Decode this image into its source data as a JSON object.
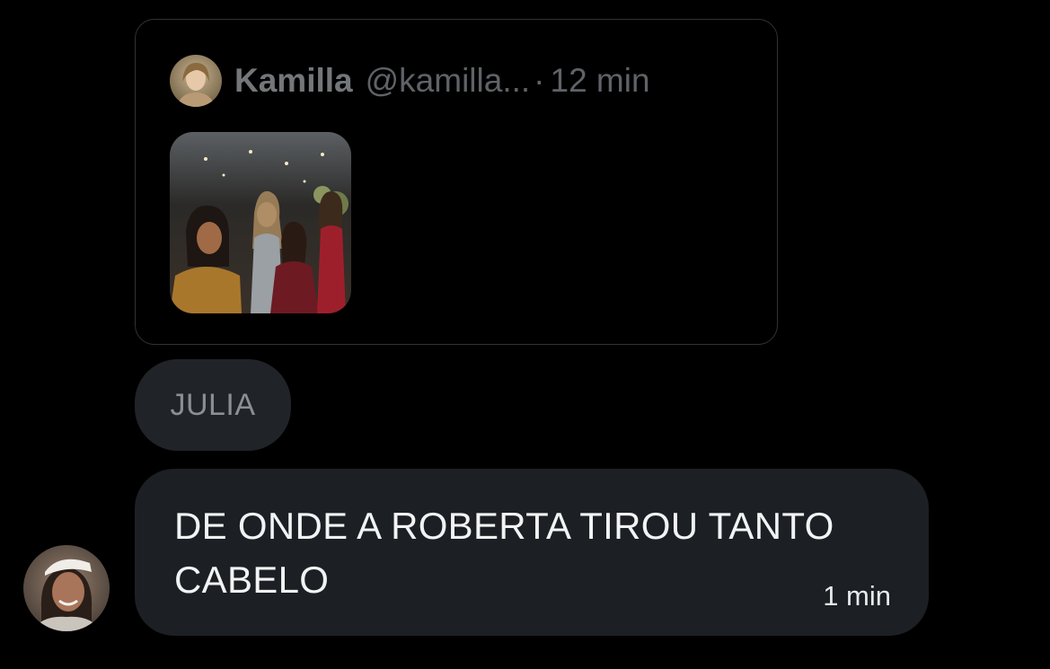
{
  "quoted_post": {
    "author_name": "Kamilla",
    "author_handle": "@kamilla...",
    "separator": "·",
    "time": "12 min"
  },
  "reply_to": {
    "label": "JULIA"
  },
  "message": {
    "text": "DE ONDE A ROBERTA TIROU TANTO CABELO",
    "time": "1 min"
  }
}
